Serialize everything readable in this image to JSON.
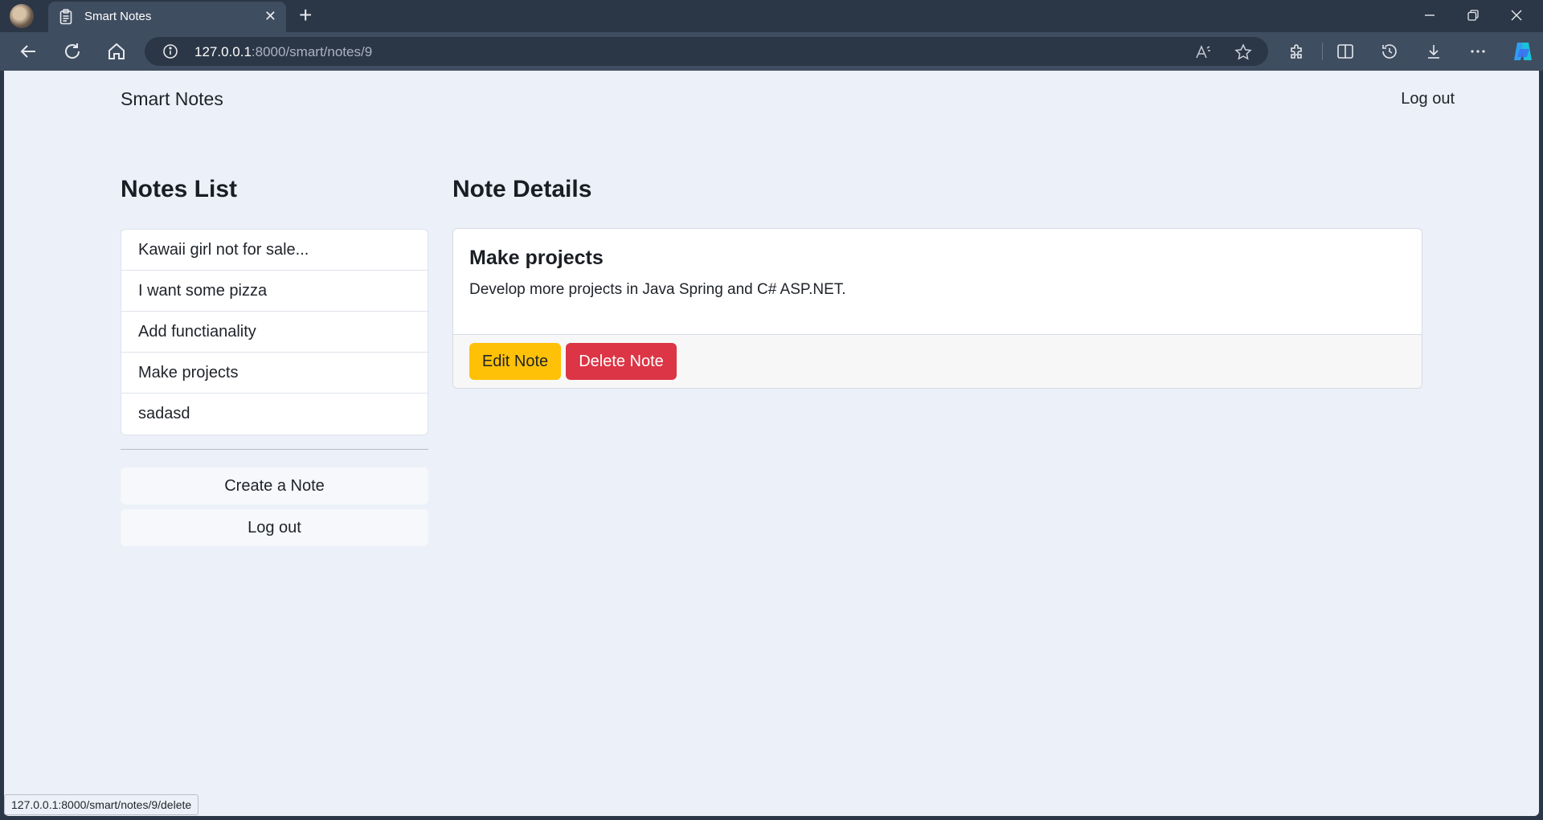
{
  "browser": {
    "tab_title": "Smart Notes",
    "close_symbol": "✕",
    "new_tab_symbol": "+",
    "url_host": "127.0.0.1",
    "url_rest": ":8000/smart/notes/9",
    "status_url": "127.0.0.1:8000/smart/notes/9/delete"
  },
  "navbar": {
    "brand": "Smart Notes",
    "logout": "Log out"
  },
  "sidebar": {
    "heading": "Notes List",
    "notes": [
      "Kawaii girl not for sale...",
      "I want some pizza",
      "Add functianality",
      "Make projects",
      "sadasd"
    ],
    "create_button": "Create a Note",
    "logout_button": "Log out"
  },
  "details": {
    "heading": "Note Details",
    "title": "Make projects",
    "body": "Develop more projects in Java Spring and C# ASP.NET.",
    "edit_button": "Edit Note",
    "delete_button": "Delete Note"
  },
  "colors": {
    "edit": "#ffc107",
    "delete": "#dc3545",
    "page_bg": "#ecf0f8",
    "chrome_bg": "#2b3646"
  },
  "icons": [
    "profile-avatar",
    "notes-icon",
    "back-icon",
    "reload-icon",
    "home-icon",
    "info-icon",
    "read-aloud-icon",
    "favorite-star-icon",
    "extensions-icon",
    "split-screen-icon",
    "history-icon",
    "download-icon",
    "more-icon",
    "copilot-icon"
  ]
}
